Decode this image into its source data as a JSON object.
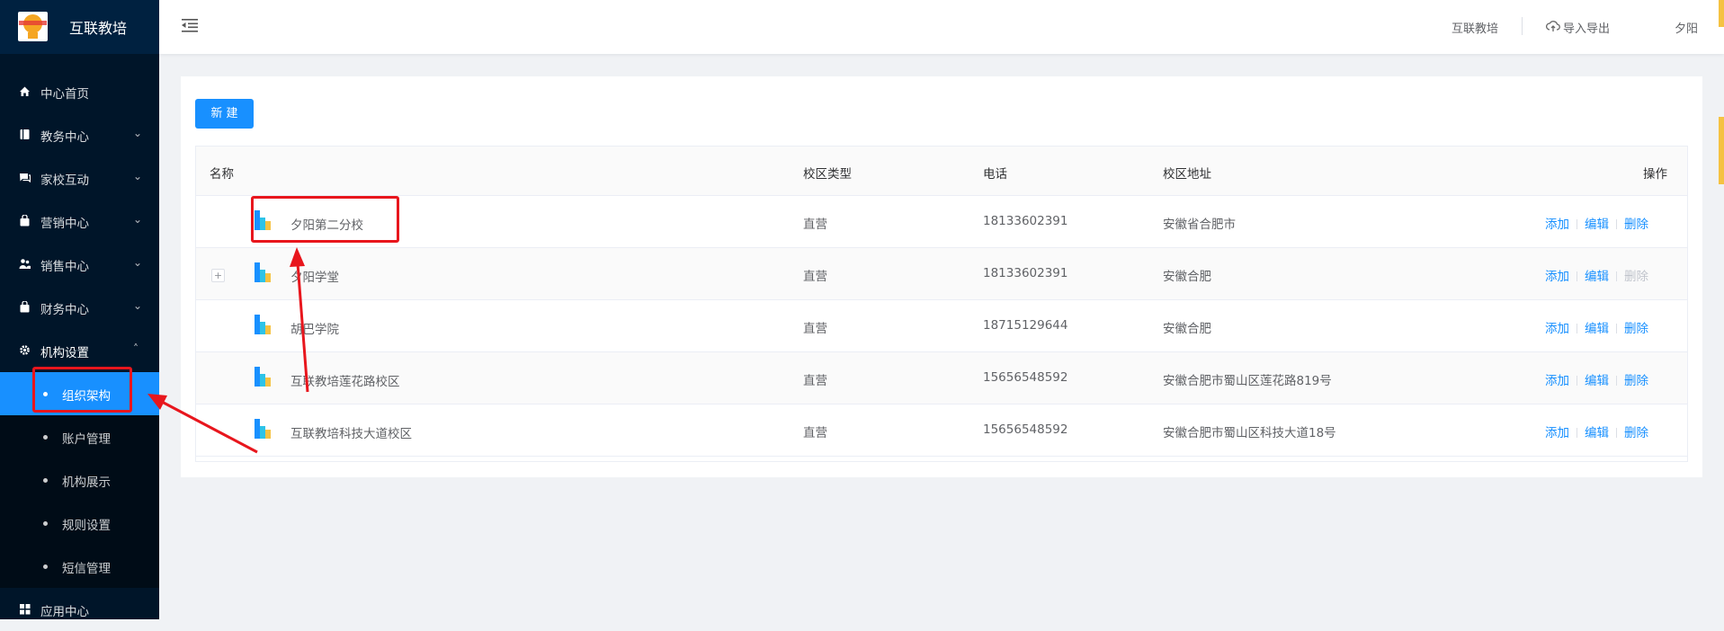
{
  "app": {
    "title": "互联教培"
  },
  "menu": [
    {
      "label": "中心首页",
      "icon": "home-icon",
      "chev": false
    },
    {
      "label": "教务中心",
      "icon": "book-icon",
      "chev": true
    },
    {
      "label": "家校互动",
      "icon": "chat-icon",
      "chev": true
    },
    {
      "label": "营销中心",
      "icon": "bag-icon",
      "chev": true
    },
    {
      "label": "销售中心",
      "icon": "users-icon",
      "chev": true
    },
    {
      "label": "财务中心",
      "icon": "wallet-icon",
      "chev": true
    },
    {
      "label": "机构设置",
      "icon": "gear-icon",
      "chev": true
    }
  ],
  "submenu": [
    "组织架构",
    "账户管理",
    "机构展示",
    "规则设置",
    "短信管理"
  ],
  "menu_app": {
    "label": "应用中心",
    "icon": "grid-icon"
  },
  "chev_down": "⌄",
  "chev_up": "˄",
  "header": {
    "org": "互联教培",
    "import_export": "导入导出",
    "user": "夕阳"
  },
  "toolbar": {
    "new_label": "新 建"
  },
  "table": {
    "columns": [
      "名称",
      "校区类型",
      "电话",
      "校区地址",
      "操作"
    ],
    "rows": [
      {
        "name": "夕阳第二分校",
        "type": "直营",
        "tel": "18133602391",
        "addr": "安徽省合肥市",
        "expand": false
      },
      {
        "name": "夕阳学堂",
        "type": "直营",
        "tel": "18133602391",
        "addr": "安徽合肥",
        "expand": true,
        "delete_disabled": true
      },
      {
        "name": "胡巴学院",
        "type": "直营",
        "tel": "18715129644",
        "addr": "安徽合肥",
        "expand": false
      },
      {
        "name": "互联教培莲花路校区",
        "type": "直营",
        "tel": "15656548592",
        "addr": "安徽合肥市蜀山区莲花路819号",
        "expand": false
      },
      {
        "name": "互联教培科技大道校区",
        "type": "直营",
        "tel": "15656548592",
        "addr": "安徽合肥市蜀山区科技大道18号",
        "expand": false
      }
    ],
    "actions": {
      "add": "添加",
      "edit": "编辑",
      "delete": "删除"
    },
    "expand_symbol": "+"
  },
  "colors": {
    "primary": "#1890ff",
    "sidebar": "#001529",
    "highlight": "#e8161d"
  }
}
